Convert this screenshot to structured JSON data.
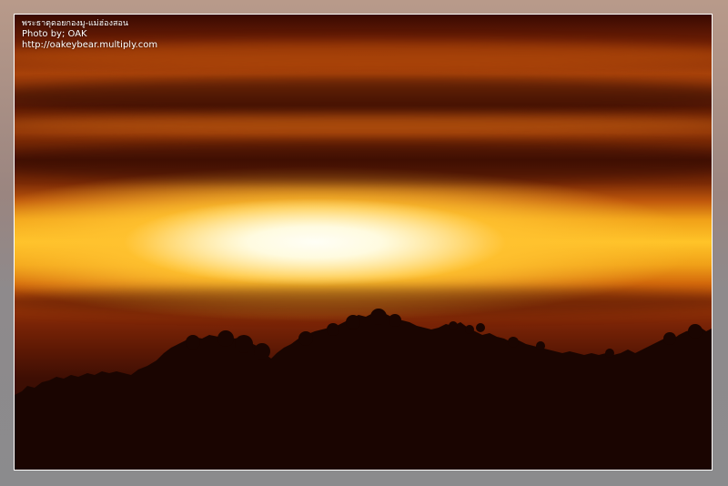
{
  "caption": {
    "location": "พระธาตุดอยกองมู-แม่ฮ่องสอน",
    "credit": "Photo by; OAK",
    "url": "http://oakeybear.multiply.com"
  },
  "colors": {
    "frame_gray": "#8b8b8d",
    "sun_core": "#fffef6",
    "glow": "#ffc428",
    "sky_dark": "#3a0a02",
    "silhouette": "#1a0501",
    "border": "#ffffff"
  }
}
